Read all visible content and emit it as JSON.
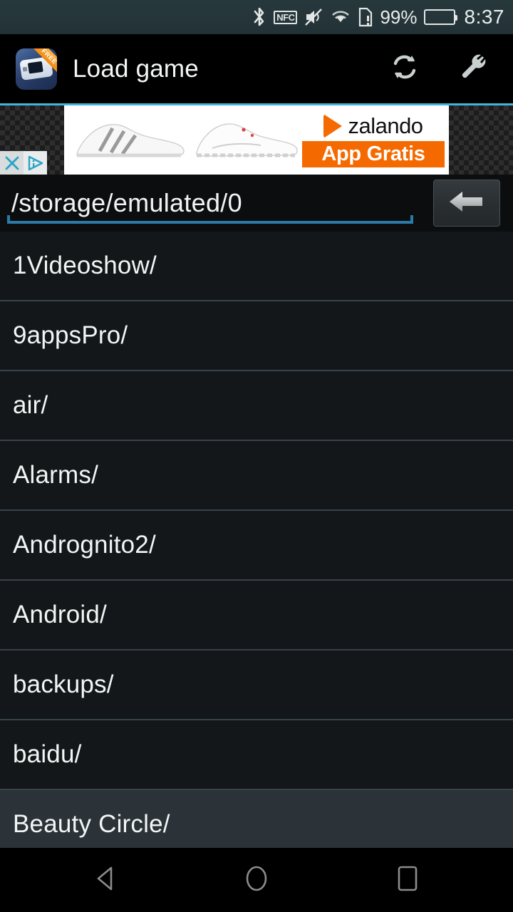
{
  "statusbar": {
    "icons": [
      "bluetooth-icon",
      "nfc-icon",
      "volume-mute-icon",
      "wifi-icon",
      "sim-alert-icon"
    ],
    "nfc_label": "NFC",
    "battery_percent": "99%",
    "time": "8:37"
  },
  "appbar": {
    "app_icon_name": "gba-emulator-icon",
    "free_badge": "FREE",
    "title": "Load game",
    "refresh_label": "refresh-icon",
    "settings_label": "wrench-icon"
  },
  "ad": {
    "brand": "zalando",
    "cta": "App Gratis",
    "close_label": "✕",
    "adchoices_label": "adchoices-icon",
    "product_1": "white-sneaker-adidas",
    "product_2": "white-sneaker-reebok"
  },
  "path": {
    "value": "/storage/emulated/0",
    "placeholder": "/storage/emulated/0",
    "back_label": "back-arrow-icon"
  },
  "files": [
    {
      "name": "1Videoshow/",
      "highlight": false
    },
    {
      "name": "9appsPro/",
      "highlight": false
    },
    {
      "name": "air/",
      "highlight": false
    },
    {
      "name": "Alarms/",
      "highlight": false
    },
    {
      "name": "Andrognito2/",
      "highlight": false
    },
    {
      "name": "Android/",
      "highlight": false
    },
    {
      "name": "backups/",
      "highlight": false
    },
    {
      "name": "baidu/",
      "highlight": false
    },
    {
      "name": "Beauty Circle/",
      "highlight": true
    }
  ],
  "navbar": {
    "back": "nav-back-icon",
    "home": "nav-home-icon",
    "recents": "nav-recents-icon"
  },
  "colors": {
    "accent_cyan": "#3fb6dd",
    "underline_blue": "#2b7ba8",
    "ad_orange": "#F56A00",
    "statusbar_bg": "#26363a",
    "list_bg": "#131719",
    "row_highlight": "#2b3339"
  }
}
